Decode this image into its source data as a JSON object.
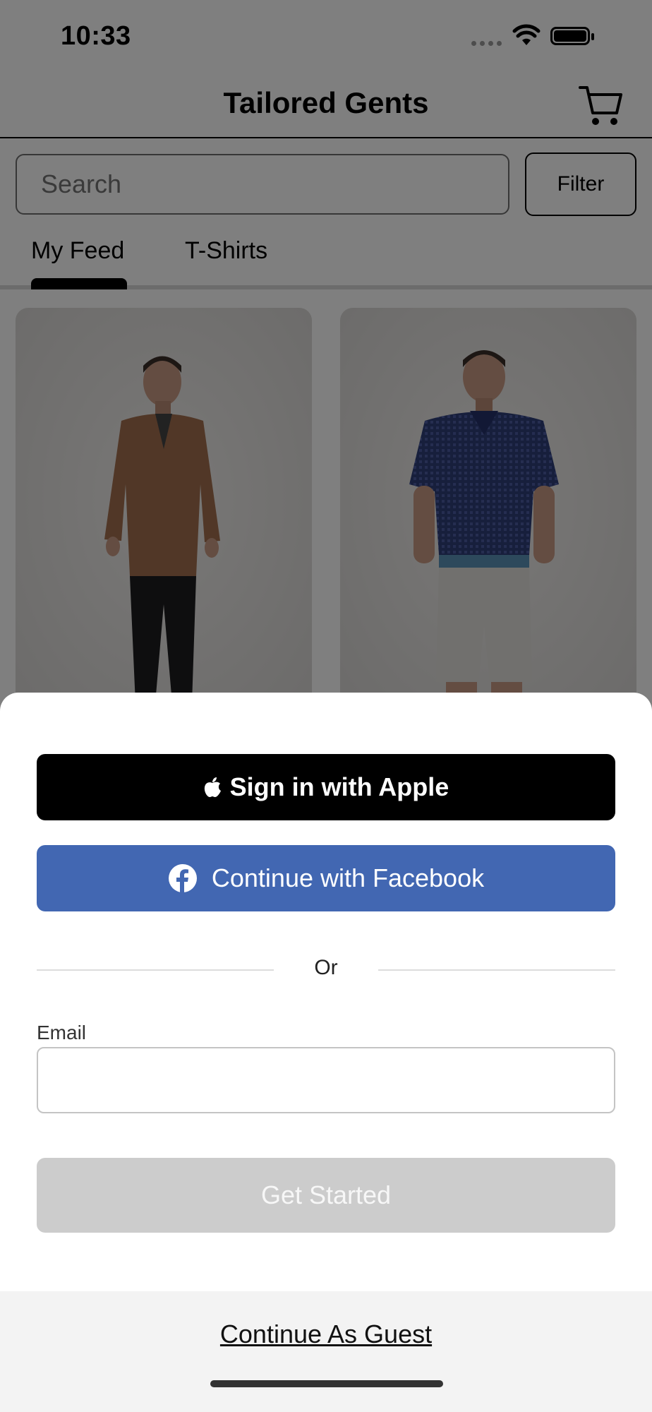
{
  "status_bar": {
    "time": "10:33",
    "icons": [
      "cellular-signal-icon",
      "wifi-icon",
      "battery-icon"
    ]
  },
  "header": {
    "title": "Tailored Gents",
    "cart_icon": "cart-icon"
  },
  "search": {
    "placeholder": "Search",
    "value": ""
  },
  "filter": {
    "label": "Filter"
  },
  "tabs": [
    {
      "label": "My Feed",
      "selected": true
    },
    {
      "label": "T-Shirts",
      "selected": false
    }
  ],
  "products": [
    {
      "image": "man-in-brown-hoodie-photo"
    },
    {
      "image": "man-in-navy-polo-photo"
    }
  ],
  "sheet": {
    "apple_button": {
      "label": "Sign in with Apple",
      "icon": "apple-icon"
    },
    "facebook_button": {
      "label": "Continue with Facebook",
      "icon": "facebook-icon"
    },
    "divider_text": "Or",
    "email": {
      "label": "Email",
      "value": "",
      "placeholder": ""
    },
    "get_started": {
      "label": "Get Started",
      "enabled": false
    },
    "guest_link": {
      "label": "Continue As Guest"
    }
  },
  "colors": {
    "facebook_blue": "#4267B2",
    "apple_black": "#000000",
    "disabled_button": "#CCCCCC",
    "overlay": "rgba(0,0,0,0.5)",
    "guest_area_bg": "#F3F3F3"
  }
}
